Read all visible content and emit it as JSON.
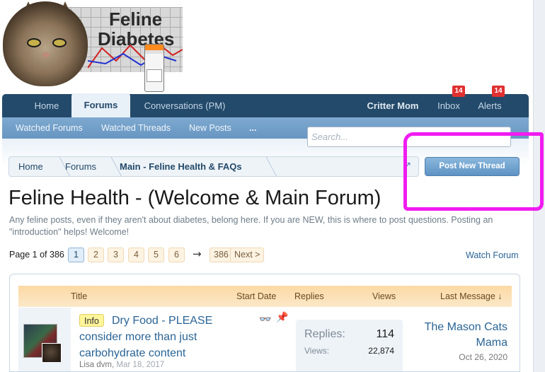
{
  "logo": {
    "line1": "Feline",
    "line2": "Diabetes"
  },
  "nav": {
    "tabs": [
      {
        "label": "Home"
      },
      {
        "label": "Forums"
      },
      {
        "label": "Conversations (PM)"
      }
    ],
    "user": "Critter Mom",
    "inbox": {
      "label": "Inbox",
      "badge": "14"
    },
    "alerts": {
      "label": "Alerts",
      "badge": "14"
    }
  },
  "subnav": {
    "links": [
      "Watched Forums",
      "Watched Threads",
      "New Posts",
      "..."
    ]
  },
  "search": {
    "placeholder": "Search..."
  },
  "breadcrumb": [
    "Home",
    "Forums",
    "Main - Feline Health & FAQs"
  ],
  "post_button": "Post New Thread",
  "forum": {
    "title": "Feline Health - (Welcome & Main Forum)",
    "description": "Any feline posts, even if they aren't about diabetes, belong here. If you are NEW, this is where to post questions. Posting an \"introduction\" helps! Welcome!"
  },
  "pagination": {
    "label": "Page 1 of 386",
    "pages": [
      "1",
      "2",
      "3",
      "4",
      "5",
      "6"
    ],
    "arrow": "→",
    "last": "386",
    "next": "Next >",
    "watch": "Watch Forum"
  },
  "table": {
    "headers": [
      "Title",
      "Start Date",
      "Replies",
      "Views",
      "Last Message ↓"
    ],
    "rows": [
      {
        "tag": "Info",
        "title": "Dry Food - PLEASE consider more than just carbohydrate content",
        "author": "Lisa dvm",
        "date": "Mar 18, 2017",
        "replies_label": "Replies:",
        "replies": "114",
        "views_label": "Views:",
        "views": "22,874",
        "last_user": "The Mason Cats Mama",
        "last_date": "Oct 26, 2020"
      }
    ]
  },
  "colors": {
    "nav": "#234a6a",
    "subnav": "#6796c2",
    "accent_link": "#2a6496",
    "annotation": "#f01cf0"
  }
}
